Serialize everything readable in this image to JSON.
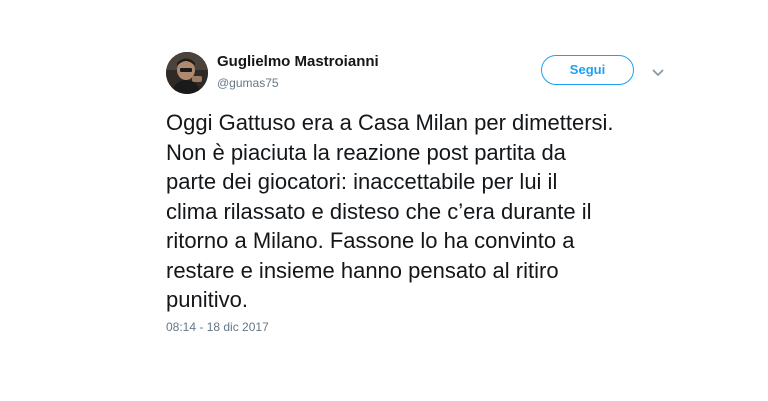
{
  "author": {
    "display_name": "Guglielmo Mastroianni",
    "handle": "@gumas75",
    "avatar_icon": "profile-photo"
  },
  "actions": {
    "follow_label": "Segui",
    "caret_icon": "chevron-down-icon"
  },
  "tweet": {
    "lines": [
      "Oggi Gattuso era a Casa Milan per dimettersi.",
      "Non è piaciuta la reazione post partita da",
      "parte dei giocatori: inaccettabile per lui il",
      "clima rilassato e disteso che c’era durante il",
      "ritorno a Milano. Fassone lo ha convinto a",
      "restare e insieme hanno pensato al ritiro",
      "punitivo."
    ],
    "timestamp": "08:14 - 18 dic 2017"
  },
  "colors": {
    "accent": "#1da1f2",
    "text": "#14171a",
    "secondary_text": "#657786",
    "background": "#ffffff"
  }
}
